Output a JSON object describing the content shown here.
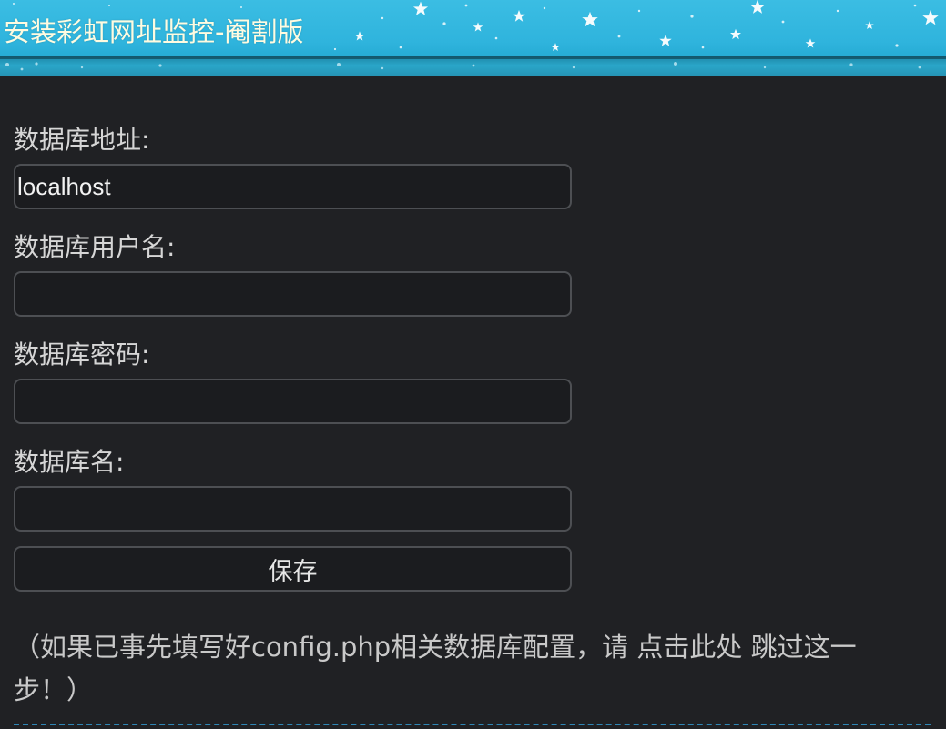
{
  "header": {
    "title": "安装彩虹网址监控-阉割版"
  },
  "form": {
    "db_host": {
      "label": "数据库地址:",
      "value": "localhost"
    },
    "db_user": {
      "label": "数据库用户名:",
      "value": ""
    },
    "db_pass": {
      "label": "数据库密码:",
      "value": ""
    },
    "db_name": {
      "label": "数据库名:",
      "value": ""
    },
    "save_label": "保存"
  },
  "note": {
    "prefix": "（如果已事先填写好config.php相关数据库配置，请 ",
    "link_text": "点击此处",
    "suffix": " 跳过这一步！）"
  },
  "colors": {
    "header_bg": "#2fb4dd",
    "title_text": "#fffbe0",
    "page_bg": "#202124",
    "divider": "#2f86b5"
  }
}
